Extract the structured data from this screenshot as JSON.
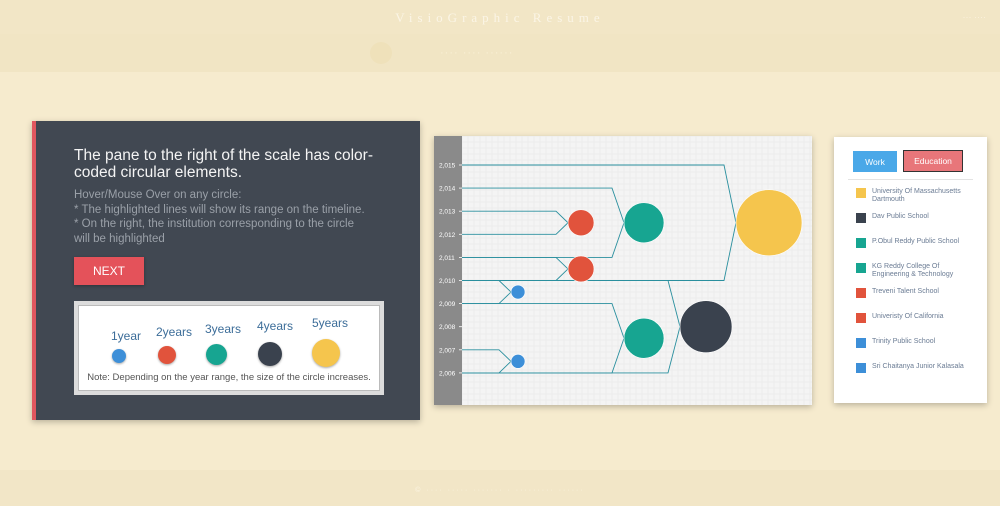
{
  "header": {
    "title": "VisioGraphic Resume",
    "right_text": "··· ····",
    "subtitle": "···· ···· ······"
  },
  "footer": {
    "text": "© ···· ····· ······· · ········· ······"
  },
  "panel": {
    "heading": "The pane to the right of the scale has color-coded circular elements.",
    "instructions": [
      "Hover/Mouse Over on any circle:",
      "* The highlighted lines will show its range on the timeline.",
      "* On the right, the institution corresponding to the circle",
      "will be highlighted"
    ],
    "next_label": "NEXT",
    "legend": [
      {
        "label": "1year",
        "color": "#3d8fd8"
      },
      {
        "label": "2years",
        "color": "#e1533c"
      },
      {
        "label": "3years",
        "color": "#17a591"
      },
      {
        "label": "4years",
        "color": "#3a424e"
      },
      {
        "label": "5years",
        "color": "#f5c54d"
      }
    ],
    "note": "Note: Depending on the year range, the size of the circle increases."
  },
  "timeline": {
    "years": [
      "2,015",
      "2,014",
      "2,013",
      "2,012",
      "2,011",
      "2,010",
      "2,009",
      "2,008",
      "2,007",
      "2,006"
    ],
    "colors": {
      "axis": "#8a8a8a",
      "line": "#2a8f9e",
      "grid": "#e6e6e6"
    }
  },
  "chart_data": {
    "type": "scatter",
    "title": "",
    "xlabel": "",
    "ylabel": "",
    "ylim": [
      2006,
      2015
    ],
    "series": [
      {
        "start": 2006,
        "end": 2007,
        "duration_years": 1,
        "color": "#3d8fd8"
      },
      {
        "start": 2009,
        "end": 2010,
        "duration_years": 1,
        "color": "#3d8fd8"
      },
      {
        "start": 2010,
        "end": 2011,
        "duration_years": 2,
        "color": "#e1533c"
      },
      {
        "start": 2012,
        "end": 2013,
        "duration_years": 2,
        "color": "#e1533c"
      },
      {
        "start": 2006,
        "end": 2009,
        "duration_years": 3,
        "color": "#17a591"
      },
      {
        "start": 2011,
        "end": 2014,
        "duration_years": 3,
        "color": "#17a591"
      },
      {
        "start": 2006,
        "end": 2010,
        "duration_years": 4,
        "color": "#3a424e"
      },
      {
        "start": 2010,
        "end": 2015,
        "duration_years": 5,
        "color": "#f5c54d"
      }
    ]
  },
  "institutions": {
    "tabs": {
      "work": "Work",
      "education": "Education"
    },
    "items": [
      {
        "name": "University Of Massachusetts Dartmouth",
        "color": "#f5c54d"
      },
      {
        "name": "Dav Public School",
        "color": "#3a424e"
      },
      {
        "name": "P.Obul Reddy Public School",
        "color": "#17a591"
      },
      {
        "name": "KG Reddy College Of Engineering & Technology",
        "color": "#17a591"
      },
      {
        "name": "Treveni Talent School",
        "color": "#e1533c"
      },
      {
        "name": "Univeristy Of California",
        "color": "#e1533c"
      },
      {
        "name": "Trinity Public School",
        "color": "#3d8fd8"
      },
      {
        "name": "Sri Chaitanya Junior Kalasala",
        "color": "#3d8fd8"
      }
    ]
  }
}
